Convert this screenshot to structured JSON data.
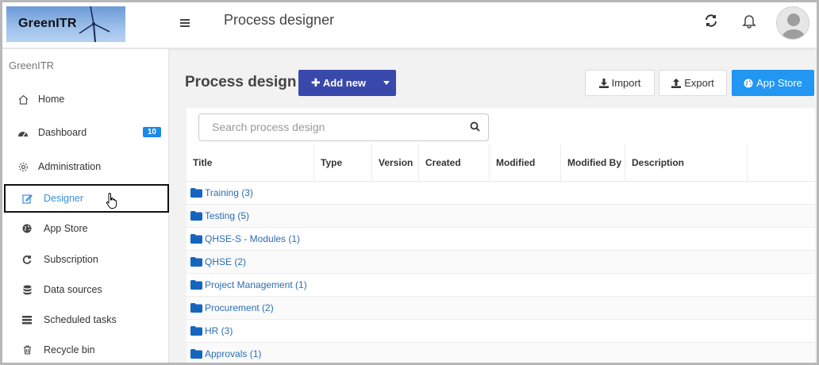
{
  "app": {
    "logo_text": "GreenITR",
    "page_heading": "Process designer"
  },
  "header_icons": [
    "menu-icon",
    "refresh-icon",
    "bell-icon",
    "user-avatar-icon"
  ],
  "sidebar": {
    "title": "GreenITR",
    "items": [
      {
        "label": "Home",
        "icon": "home-icon"
      },
      {
        "label": "Dashboard",
        "icon": "dashboard-icon",
        "badge": "10"
      },
      {
        "label": "Administration",
        "icon": "gear-icon"
      },
      {
        "label": "Designer",
        "icon": "edit-icon",
        "active": true
      },
      {
        "label": "App Store",
        "icon": "globe-icon"
      },
      {
        "label": "Subscription",
        "icon": "refresh-icon"
      },
      {
        "label": "Data sources",
        "icon": "database-icon"
      },
      {
        "label": "Scheduled tasks",
        "icon": "tasks-icon"
      },
      {
        "label": "Recycle bin",
        "icon": "trash-icon"
      }
    ]
  },
  "main": {
    "title": "Process design",
    "add_new_label": "Add new",
    "import_label": "Import",
    "export_label": "Export",
    "appstore_label": "App Store",
    "search_placeholder": "Search process design",
    "columns": [
      "Title",
      "Type",
      "Version",
      "Created",
      "Modified",
      "Modified By",
      "Description"
    ],
    "rows": [
      "Training (3)",
      "Testing (5)",
      "QHSE-S - Modules (1)",
      "QHSE (2)",
      "Project Management (1)",
      "Procurement (2)",
      "HR (3)",
      "Approvals (1)"
    ]
  },
  "colors": {
    "primary_button": "#3949ab",
    "info_button": "#2196f3",
    "link": "#2c6db3",
    "badge": "#1e88e5"
  }
}
